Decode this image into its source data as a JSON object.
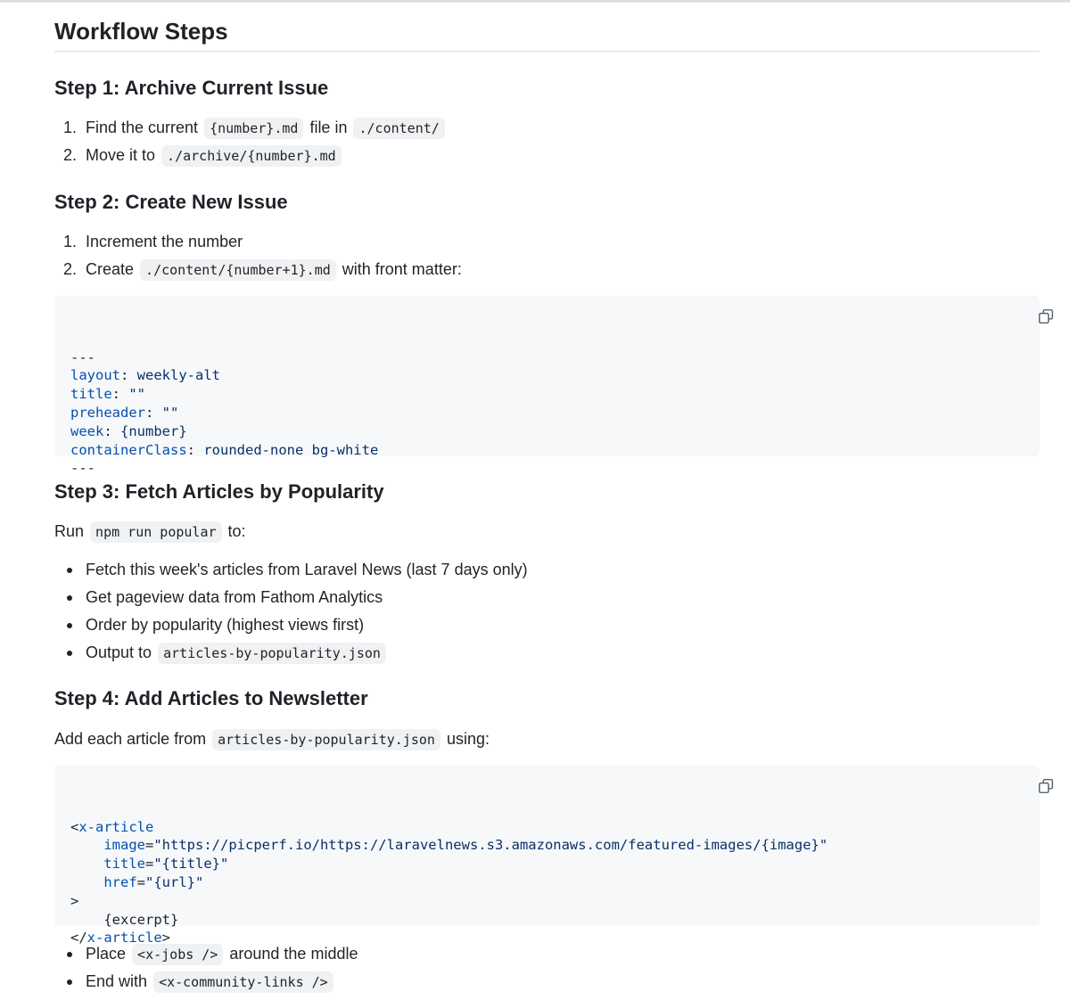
{
  "title": "Workflow Steps",
  "step1": {
    "heading": "Step 1: Archive Current Issue",
    "items": [
      {
        "num": "1.",
        "pre": "Find the current",
        "code1": "{number}.md",
        "mid": "file in",
        "code2": "./content/"
      },
      {
        "num": "2.",
        "pre": "Move it to",
        "code1": "./archive/{number}.md"
      }
    ]
  },
  "step2": {
    "heading": "Step 2: Create New Issue",
    "items": [
      {
        "num": "1.",
        "text": "Increment the number"
      },
      {
        "num": "2.",
        "pre": "Create",
        "code1": "./content/{number+1}.md",
        "post": "with front matter:"
      }
    ],
    "code": {
      "sep_open": "---",
      "layout_key": "layout",
      "layout_val": "weekly-alt",
      "title_key": "title",
      "title_val": "\"\"",
      "preheader_key": "preheader",
      "preheader_val": "\"\"",
      "week_key": "week",
      "week_val": "{number}",
      "container_key": "containerClass",
      "container_val": "rounded-none bg-white",
      "sep_close": "---",
      "colon": ": "
    }
  },
  "step3": {
    "heading": "Step 3: Fetch Articles by Popularity",
    "run_pre": "Run",
    "run_code": "npm run popular",
    "run_post": "to:",
    "bullets": [
      {
        "text": "Fetch this week's articles from Laravel News (last 7 days only)"
      },
      {
        "text": "Get pageview data from Fathom Analytics"
      },
      {
        "text": "Order by popularity (highest views first)"
      },
      {
        "pre": "Output to",
        "code": "articles-by-popularity.json"
      }
    ]
  },
  "step4": {
    "heading": "Step 4: Add Articles to Newsletter",
    "intro_pre": "Add each article from",
    "intro_code": "articles-by-popularity.json",
    "intro_post": "using:",
    "code": {
      "open_lt": "<",
      "tag": "x-article",
      "indent": "    ",
      "image_attr": "image",
      "image_val": "\"https://picperf.io/https://laravelnews.s3.amazonaws.com/featured-images/{image}\"",
      "title_attr": "title",
      "title_val": "\"{title}\"",
      "href_attr": "href",
      "href_val": "\"{url}\"",
      "eq": "=",
      "gt": ">",
      "body": "{excerpt}",
      "close_lt": "</",
      "close_gt": ">"
    },
    "bullets": [
      {
        "pre": "Place",
        "code": "<x-jobs />",
        "post": "around the middle"
      },
      {
        "pre": "End with",
        "code": "<x-community-links />"
      }
    ]
  },
  "icons": {
    "copy": "copy-icon"
  }
}
